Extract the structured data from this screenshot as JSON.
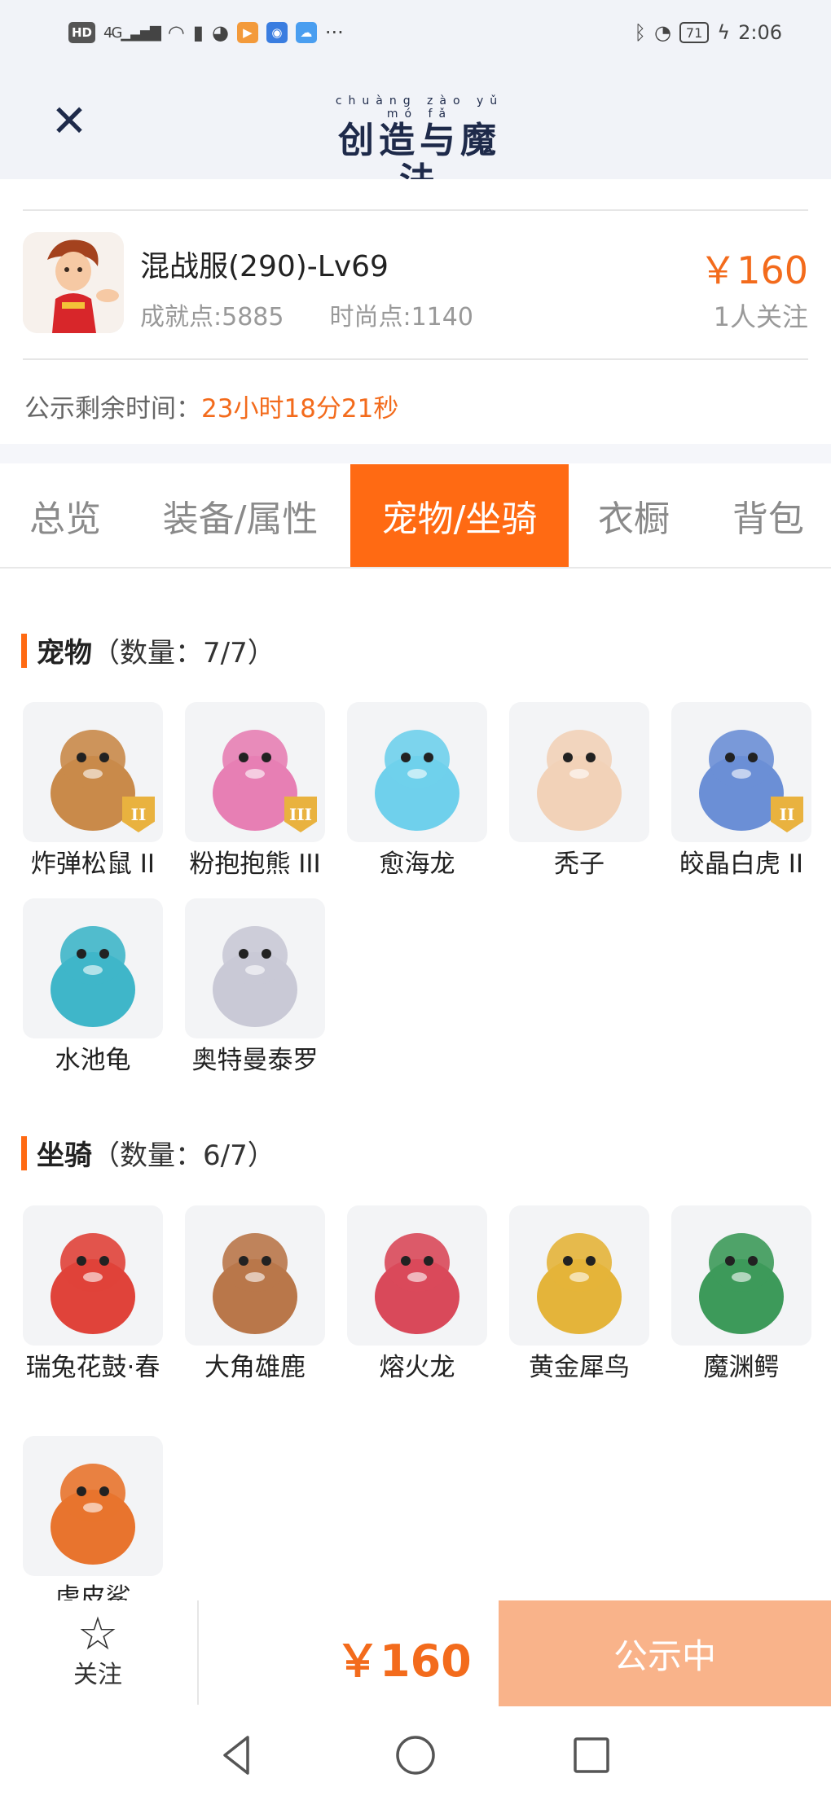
{
  "status_bar": {
    "hd": "HD",
    "signal": "4G",
    "time": "2:06",
    "battery": "71",
    "more": "···"
  },
  "header": {
    "logo_pinyin": "chuàng zào yǔ mó fǎ",
    "logo_text": "创造与魔法"
  },
  "account": {
    "title": "混战服(290)-Lv69",
    "achievement": "成就点:5885",
    "fashion": "时尚点:1140",
    "price": "￥160",
    "followers": "1人关注",
    "notice_label": "公示剩余时间：",
    "notice_time": "23小时18分21秒"
  },
  "tabs": [
    {
      "label": "总览"
    },
    {
      "label": "装备/属性"
    },
    {
      "label": "宠物/坐骑"
    },
    {
      "label": "衣橱"
    },
    {
      "label": "背包"
    }
  ],
  "pets": {
    "title": "宠物",
    "count": "（数量：7/7）",
    "items": [
      {
        "name": "炸弹松鼠 II",
        "badge": "II",
        "color": "#c98a4a"
      },
      {
        "name": "粉抱抱熊 III",
        "badge": "III",
        "color": "#e77fb4"
      },
      {
        "name": "愈海龙",
        "badge": "",
        "color": "#6fd0ec"
      },
      {
        "name": "秃子",
        "badge": "",
        "color": "#f2d2b8"
      },
      {
        "name": "皎晶白虎 II",
        "badge": "II",
        "color": "#6b8fd6"
      },
      {
        "name": "水池龟",
        "badge": "",
        "color": "#3fb6c9"
      },
      {
        "name": "奥特曼泰罗",
        "badge": "",
        "color": "#c9c9d6"
      }
    ]
  },
  "mounts": {
    "title": "坐骑",
    "count": "（数量：6/7）",
    "items": [
      {
        "name": "瑞兔花鼓·春",
        "color": "#e0433a"
      },
      {
        "name": "大角雄鹿",
        "color": "#b9774a"
      },
      {
        "name": "熔火龙",
        "color": "#d9495a"
      },
      {
        "name": "黄金犀鸟",
        "color": "#e4b43a"
      },
      {
        "name": "魔渊鳄",
        "color": "#3d9a5a"
      },
      {
        "name": "虎皮鲨",
        "color": "#e8742e"
      }
    ]
  },
  "bottom": {
    "follow_label": "关注",
    "price": "￥160",
    "action": "公示中"
  }
}
